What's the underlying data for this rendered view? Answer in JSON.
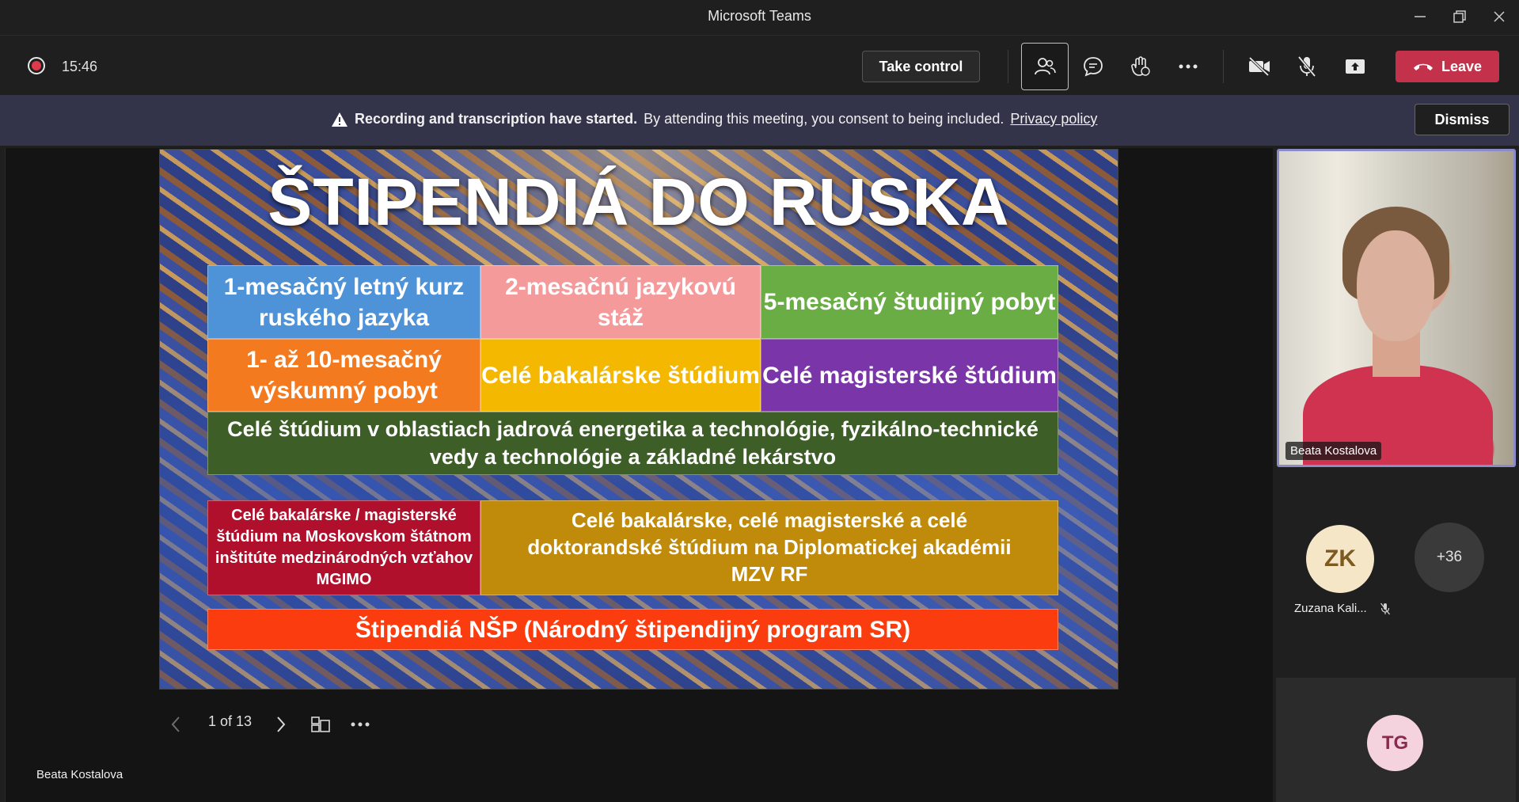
{
  "window": {
    "title": "Microsoft Teams"
  },
  "toolbar": {
    "timer": "15:46",
    "take_control_label": "Take control",
    "leave_label": "Leave"
  },
  "banner": {
    "bold_text": "Recording and transcription have started.",
    "text": "By attending this meeting, you consent to being included.",
    "link_text": "Privacy policy",
    "dismiss_label": "Dismiss"
  },
  "slide": {
    "title": "ŠTIPENDIÁ DO RUSKA",
    "boxes": [
      {
        "text": "1-mesačný letný kurz ruského jazyka",
        "color": "#4e92d8"
      },
      {
        "text": "2-mesačnú jazykovú stáž",
        "color": "#f59a9b"
      },
      {
        "text": "5-mesačný študijný pobyt",
        "color": "#6aad45"
      },
      {
        "text": "1- až 10-mesačný výskumný pobyt",
        "color": "#f47a1f"
      },
      {
        "text": "Celé bakalárske štúdium",
        "color": "#f5b800"
      },
      {
        "text": "Celé magisterské štúdium",
        "color": "#7a35a8"
      },
      {
        "text": "Celé štúdium v oblastiach jadrová energetika a technológie, fyzikálno-technické vedy a technológie a základné lekárstvo",
        "color": "#3d5e27"
      },
      {
        "text": "Celé bakalárske / magisterské štúdium na Moskovskom štátnom inštitúte medzinárodných vzťahov MGIMO",
        "color": "#b0102c"
      },
      {
        "text": "Celé bakalárske, celé magisterské a celé doktorandské štúdium na Diplomatickej akadémii MZV RF",
        "color": "#c08a0a"
      },
      {
        "text": "Štipendiá NŠP (Národný štipendijný program SR)",
        "color": "#fb3c0e"
      }
    ]
  },
  "slide_nav": {
    "page_indicator": "1 of 13"
  },
  "presenter": {
    "name": "Beata Kostalova"
  },
  "participants": {
    "main_video_name": "Beata Kostalova",
    "zk": {
      "initials": "ZK",
      "name": "Zuzana Kali..."
    },
    "overflow": "+36",
    "tg": {
      "initials": "TG"
    }
  }
}
